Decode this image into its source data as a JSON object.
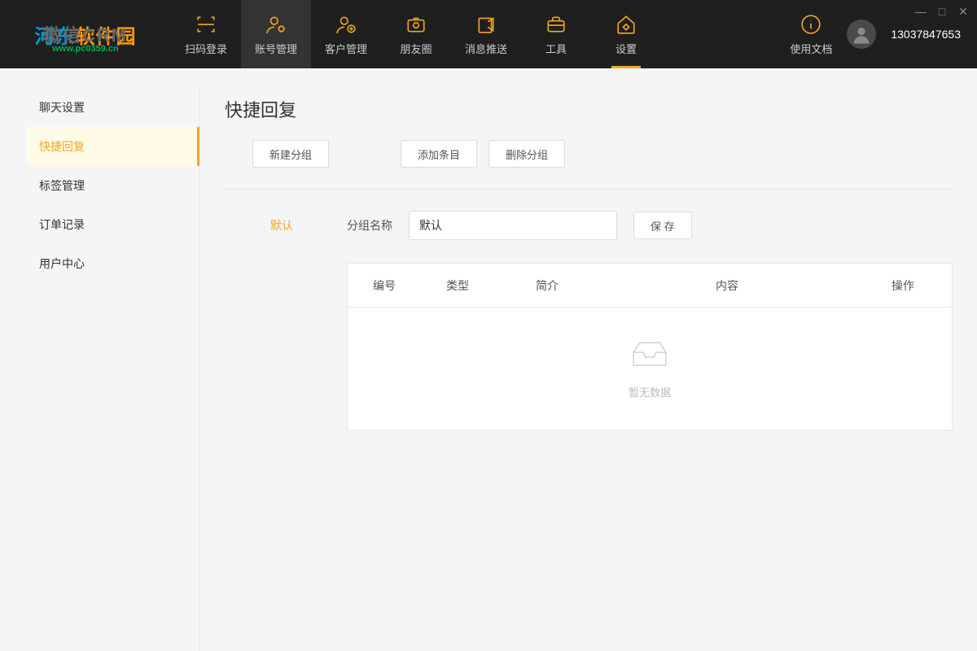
{
  "brand": {
    "title_primary": "河东",
    "title_secondary": "软件园",
    "subtitle": "www.pc0359.cn",
    "watermark": "微信CRM"
  },
  "nav": {
    "items": [
      {
        "label": "扫码登录",
        "icon": "scan"
      },
      {
        "label": "账号管理",
        "icon": "account"
      },
      {
        "label": "客户管理",
        "icon": "customer"
      },
      {
        "label": "朋友圈",
        "icon": "camera"
      },
      {
        "label": "消息推送",
        "icon": "push"
      },
      {
        "label": "工具",
        "icon": "toolbox"
      },
      {
        "label": "设置",
        "icon": "settings"
      }
    ],
    "active_index": 1,
    "selected_index": 6,
    "docs_label": "使用文档",
    "user_id": "13037847653"
  },
  "sidebar": {
    "items": [
      {
        "label": "聊天设置"
      },
      {
        "label": "快捷回复"
      },
      {
        "label": "标签管理"
      },
      {
        "label": "订单记录"
      },
      {
        "label": "用户中心"
      }
    ],
    "active_index": 1
  },
  "panel": {
    "title": "快捷回复",
    "actions": {
      "new_group": "新建分组",
      "add_item": "添加条目",
      "delete_group": "删除分组"
    },
    "default_tab": "默认",
    "group_name_label": "分组名称",
    "group_name_value": "默认",
    "save_label": "保 存",
    "table": {
      "headers": {
        "id": "编号",
        "type": "类型",
        "summary": "简介",
        "content": "内容",
        "action": "操作"
      },
      "empty_text": "暂无数据"
    }
  }
}
